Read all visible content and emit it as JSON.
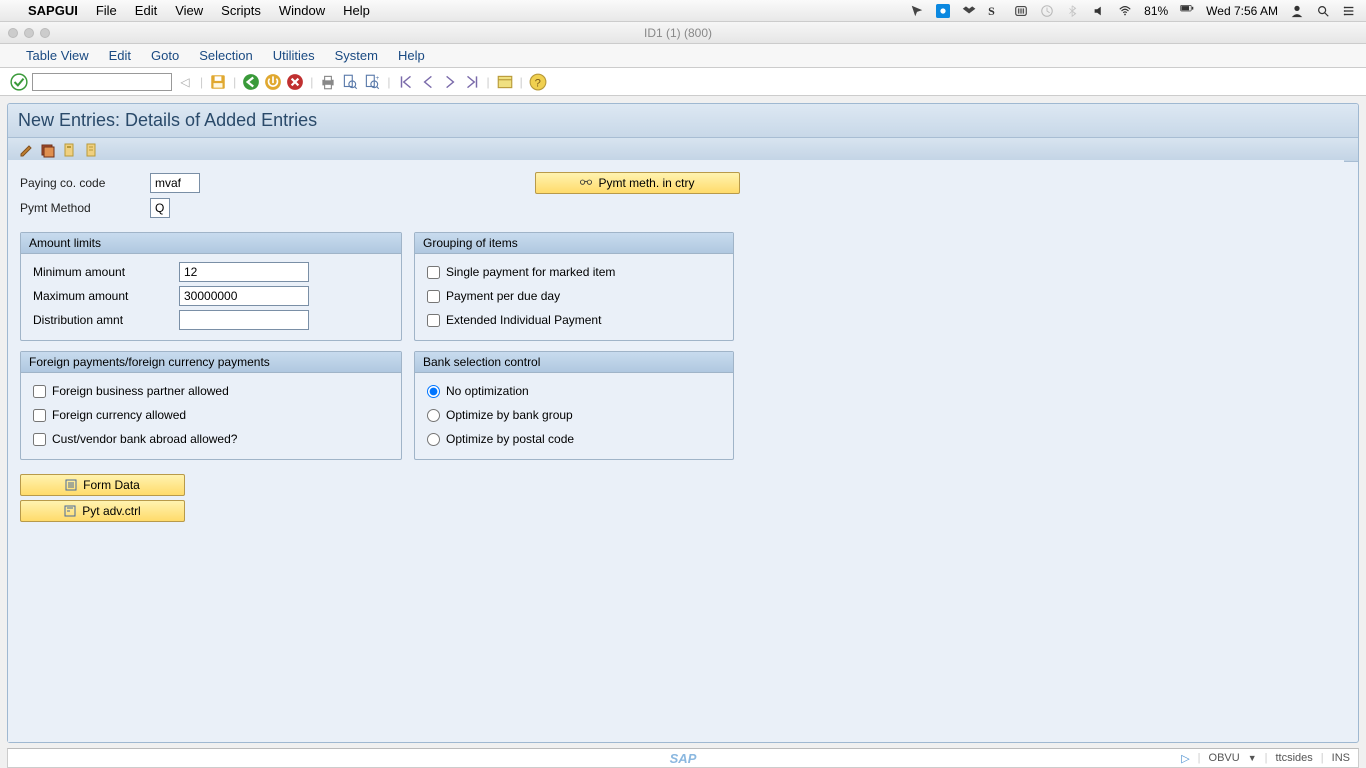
{
  "macMenu": {
    "appName": "SAPGUI",
    "items": [
      "File",
      "Edit",
      "View",
      "Scripts",
      "Window",
      "Help"
    ],
    "battery": "81%",
    "clock": "Wed 7:56 AM"
  },
  "windowTitle": "ID1 (1) (800)",
  "sapMenu": [
    "Table View",
    "Edit",
    "Goto",
    "Selection",
    "Utilities",
    "System",
    "Help"
  ],
  "screenTitle": "New Entries: Details of Added Entries",
  "header": {
    "payingCoCodeLabel": "Paying co. code",
    "payingCoCodeValue": "mvaf",
    "pymtMethodLabel": "Pymt Method",
    "pymtMethodValue": "Q",
    "pymtMethInCtryBtn": "Pymt meth. in ctry"
  },
  "amountLimits": {
    "title": "Amount limits",
    "minLabel": "Minimum amount",
    "minValue": "12",
    "maxLabel": "Maximum amount",
    "maxValue": "30000000",
    "distLabel": "Distribution amnt",
    "distValue": ""
  },
  "grouping": {
    "title": "Grouping of items",
    "opt1": "Single payment for marked item",
    "opt2": "Payment per due day",
    "opt3": "Extended Individual Payment"
  },
  "foreign": {
    "title": "Foreign payments/foreign currency payments",
    "opt1": "Foreign business partner allowed",
    "opt2": "Foreign currency allowed",
    "opt3": "Cust/vendor bank abroad allowed?"
  },
  "bankSel": {
    "title": "Bank selection control",
    "opt1": "No optimization",
    "opt2": "Optimize by bank group",
    "opt3": "Optimize by postal code"
  },
  "buttons": {
    "formData": "Form Data",
    "pytAdvCtrl": "Pyt adv.ctrl"
  },
  "status": {
    "sapLogo": "SAP",
    "field1": "OBVU",
    "field2": "ttcsides",
    "field3": "INS"
  }
}
